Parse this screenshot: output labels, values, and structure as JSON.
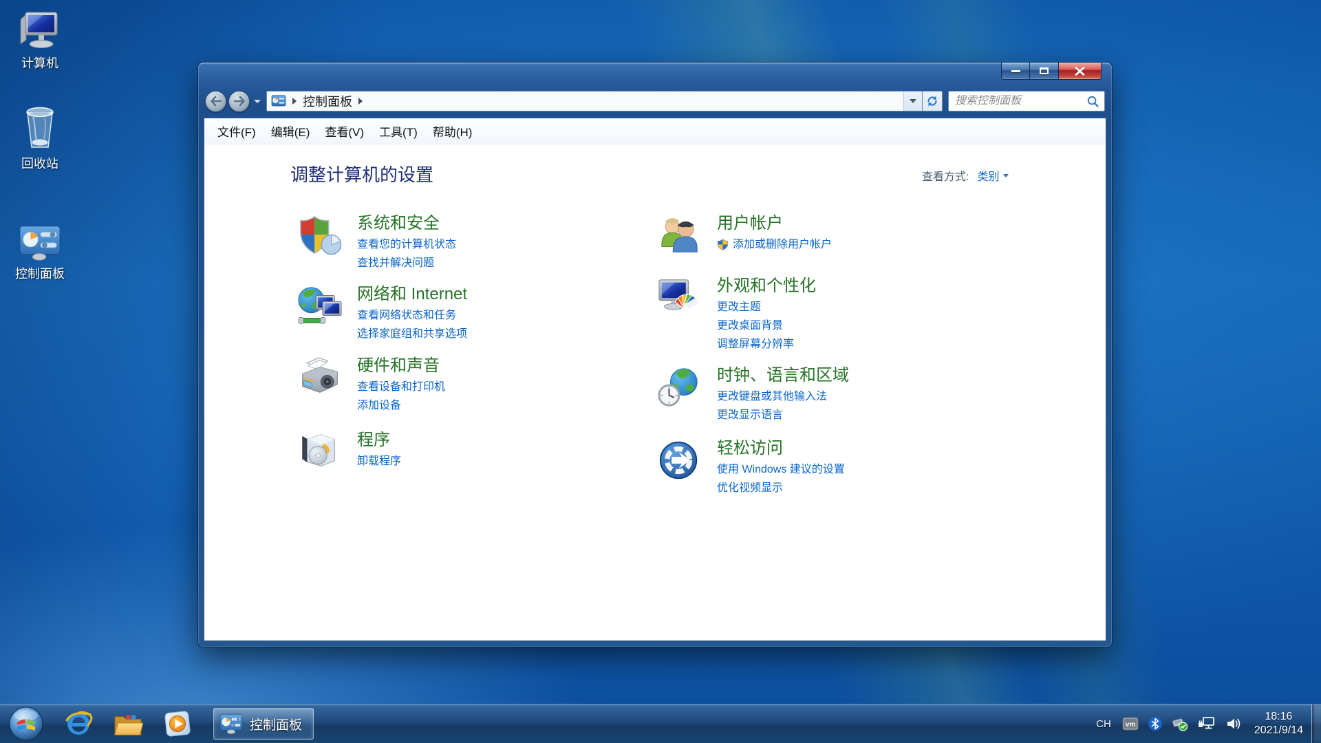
{
  "desktop": {
    "icons": [
      {
        "label": "计算机",
        "icon": "computer-icon"
      },
      {
        "label": "回收站",
        "icon": "recycle-bin-icon"
      },
      {
        "label": "控制面板",
        "icon": "control-panel-icon"
      }
    ]
  },
  "window": {
    "address": {
      "root": "控制面板"
    },
    "search_placeholder": "搜索控制面板",
    "menu": [
      "文件(F)",
      "编辑(E)",
      "查看(V)",
      "工具(T)",
      "帮助(H)"
    ],
    "heading": "调整计算机的设置",
    "view_by": {
      "label": "查看方式:",
      "value": "类别"
    },
    "categories": [
      {
        "title": "系统和安全",
        "icon": "system-security-icon",
        "links": [
          "查看您的计算机状态",
          "查找并解决问题"
        ]
      },
      {
        "title": "网络和 Internet",
        "icon": "network-internet-icon",
        "links": [
          "查看网络状态和任务",
          "选择家庭组和共享选项"
        ]
      },
      {
        "title": "硬件和声音",
        "icon": "hardware-sound-icon",
        "links": [
          "查看设备和打印机",
          "添加设备"
        ]
      },
      {
        "title": "程序",
        "icon": "programs-icon",
        "links": [
          "卸载程序"
        ]
      },
      {
        "title": "用户帐户",
        "icon": "user-accounts-icon",
        "links": [
          "添加或删除用户帐户"
        ],
        "shield_link": true
      },
      {
        "title": "外观和个性化",
        "icon": "appearance-icon",
        "links": [
          "更改主题",
          "更改桌面背景",
          "调整屏幕分辨率"
        ]
      },
      {
        "title": "时钟、语言和区域",
        "icon": "clock-language-icon",
        "links": [
          "更改键盘或其他输入法",
          "更改显示语言"
        ]
      },
      {
        "title": "轻松访问",
        "icon": "ease-of-access-icon",
        "links": [
          "使用 Windows 建议的设置",
          "优化视频显示"
        ]
      }
    ]
  },
  "taskbar": {
    "task_label": "控制面板",
    "tray": {
      "input_indicator": "CH",
      "vm_label": "vm",
      "time": "18:16",
      "date": "2021/9/14"
    }
  },
  "colors": {
    "category_title_green": "#267326",
    "link_blue": "#0a66cc",
    "heading_navy": "#203077",
    "close_button_red": "#a91e23"
  }
}
